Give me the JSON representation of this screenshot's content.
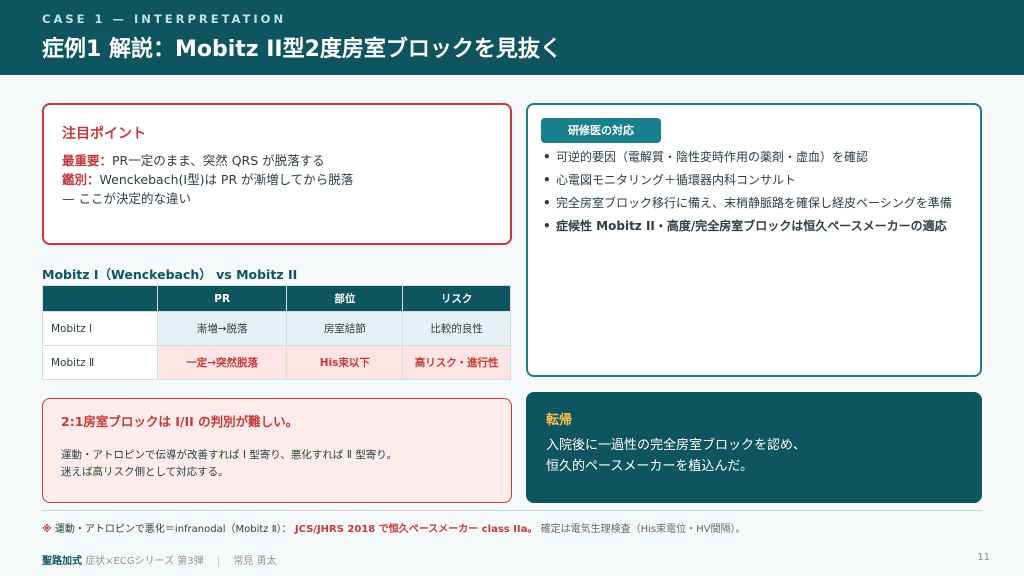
{
  "header": {
    "kicker": "CASE 1 — INTERPRETATION",
    "title": "症例1 解説：Mobitz II型2度房室ブロックを見抜く"
  },
  "focus": {
    "heading": "注目ポイント",
    "line1_label": "最重要：",
    "line1_text": "PR一定のまま、突然 QRS が脱落する",
    "line2_label": "鑑別：",
    "line2_text": "Wenckebach(I型)は PR が漸増してから脱落",
    "line3_text": "— ここが決定的な違い"
  },
  "comparison": {
    "title": "Mobitz I（Wenckebach） vs Mobitz II",
    "headers": [
      "",
      "PR",
      "部位",
      "リスク"
    ],
    "rows": [
      {
        "name": "Mobitz Ⅰ",
        "cells": [
          "漸増→脱落",
          "房室結節",
          "比較的良性"
        ]
      },
      {
        "name": "Mobitz Ⅱ",
        "cells": [
          "一定→突然脱落",
          "His束以下",
          "高リスク・進行性"
        ]
      }
    ]
  },
  "warning": {
    "heading": "2:1房室ブロックは I/II の判別が難しい。",
    "line1": "運動・アトロピンで伝導が改善すれば Ⅰ 型寄り、悪化すれば Ⅱ 型寄り。",
    "line2": "迷えば高リスク側として対応する。"
  },
  "resident": {
    "badge": "研修医の対応",
    "items": [
      "可逆的要因（電解質・陰性変時作用の薬剤・虚血）を確認",
      "心電図モニタリング＋循環器内科コンサルト",
      "完全房室ブロック移行に備え、末梢静脈路を確保し経皮ペーシングを準備",
      "症候性 Mobitz II・高度/完全房室ブロックは恒久ペースメーカーの適応"
    ]
  },
  "outcome": {
    "heading": "転帰",
    "line1": "入院後に一過性の完全房室ブロックを認め、",
    "line2": "恒久的ペースメーカーを植込んだ。"
  },
  "note": {
    "mark": "※",
    "text1": "運動・アトロピンで悪化＝infranodal（Mobitz Ⅱ）：",
    "emphasis": "JCS/JHRS 2018 で恒久ペースメーカー class IIa。",
    "text2": "確定は電気生理検査（His束電位・HV間隔）。"
  },
  "footer": {
    "brand": "聖路加式",
    "series": "症状×ECGシリーズ 第3弾",
    "author": "常見 勇太",
    "page": "11"
  },
  "colors": {
    "primary": "#0f5560",
    "accent_red": "#c43a3a",
    "teal": "#1a7f8c",
    "gold": "#f2c14e"
  }
}
